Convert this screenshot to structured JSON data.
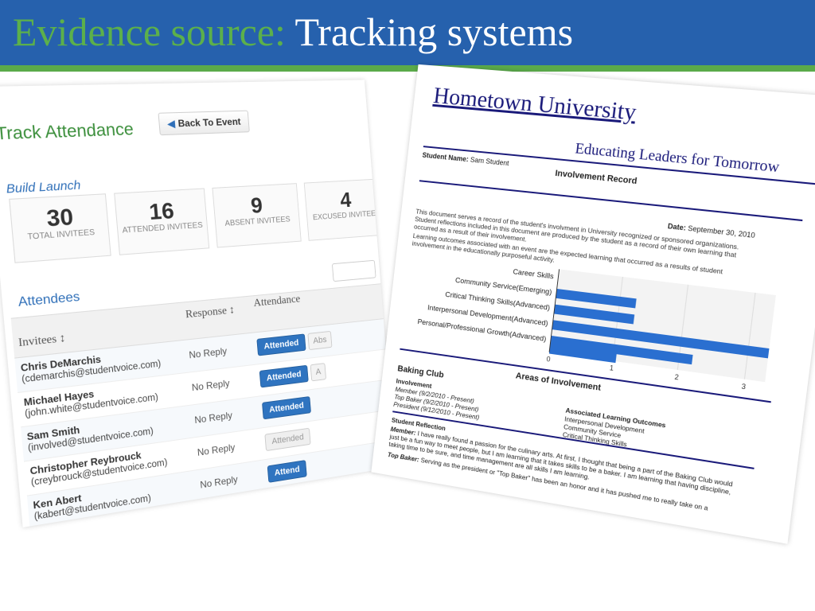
{
  "header": {
    "title_prefix": "Evidence source:",
    "title_rest": "Tracking systems",
    "colors": {
      "bar": "#2661ad",
      "rule": "#5aaa4a",
      "prefix": "#5cb04b"
    }
  },
  "attendance_shot": {
    "heading": "Track Attendance",
    "back_button": "Back To Event",
    "event_name": "Build Launch",
    "stats": [
      {
        "number": "30",
        "label": "TOTAL INVITEES"
      },
      {
        "number": "16",
        "label": "ATTENDED INVITEES"
      },
      {
        "number": "9",
        "label": "ABSENT INVITEES"
      },
      {
        "number": "4",
        "label": "EXCUSED INVITEES"
      }
    ],
    "attendees_heading": "Attendees",
    "columns": {
      "invitees": "Invitees ↕",
      "response": "Response ↕",
      "attendance": "Attendance"
    },
    "rows": [
      {
        "name": "Chris DeMarchis",
        "email": "(cdemarchis@studentvoice.com)",
        "response": "No Reply",
        "attendance": "Attended",
        "alt": "Abs"
      },
      {
        "name": "Michael Hayes",
        "email": "(john.white@studentvoice.com)",
        "response": "No Reply",
        "attendance": "Attended",
        "alt": "A"
      },
      {
        "name": "Sam Smith",
        "email": "(involved@studentvoice.com)",
        "response": "No Reply",
        "attendance": "Attended",
        "alt": ""
      },
      {
        "name": "Christopher Reybrouck",
        "email": "(creybrouck@studentvoice.com)",
        "response": "No Reply",
        "attendance": "Attended",
        "alt": ""
      },
      {
        "name": "Ken Abert",
        "email": "(kabert@studentvoice.com)",
        "response": "No Reply",
        "attendance": "Attend",
        "alt": ""
      }
    ]
  },
  "record_shot": {
    "university": "Hometown University",
    "tagline": "Educating Leaders for Tomorrow",
    "student_label": "Student Name:",
    "student_name": "Sam Student",
    "record_title": "Involvement Record",
    "date_label": "Date:",
    "date": "September 30, 2010",
    "intro_1": "This document serves a record of the student's involvment in University recognized or sponsored organizations. Student reflections included in this document are produced by the student as a record of their own learning that occurred as a result of their involvement.",
    "intro_2": "Learning outcomes associated with an event are the expected learning that occurred as a results of student involvement in the educationally purposeful activity.",
    "areas_title": "Areas of Involvement",
    "club_name": "Baking Club",
    "involvement_label": "Involvement",
    "memberships": [
      "Member (9/2/2010 - Present)",
      "Top Baker (9/2/2010 - Present)",
      "President (9/12/2010 - Present)"
    ],
    "outcomes_label": "Associated Learning Outcomes",
    "outcomes": [
      "Interpersonal Development",
      "Community Service",
      "Critical Thinking Skills"
    ],
    "reflection_label": "Student Reflection",
    "reflection_member_label": "Member:",
    "reflection_member": "I have really found a passion for the culinary arts. At first, I thought that being a part of the Baking Club would just be a fun way to meet people, but I am learning that it takes skills to be a baker. I am learning that having discipline, taking time to be sure, and time management are all skills I am learning.",
    "reflection_top_label": "Top Baker:",
    "reflection_top": "Serving as the president or \"Top Baker\" has been an honor and it has pushed me to really take on a"
  },
  "chart_data": {
    "type": "bar",
    "orientation": "horizontal",
    "categories": [
      "Career Skills",
      "Community Service(Emerging)",
      "Critical Thinking Skills(Advanced)",
      "Interpersonal Development(Advanced)",
      "Personal/Professional Growth(Advanced)"
    ],
    "values": [
      0,
      1.25,
      1.25,
      3.3,
      2.2
    ],
    "extra_bar": 1.05,
    "xlim": [
      0,
      3.3
    ],
    "xticks": [
      "0",
      "1",
      "2",
      "3"
    ],
    "bar_color": "#2a6fd0"
  }
}
